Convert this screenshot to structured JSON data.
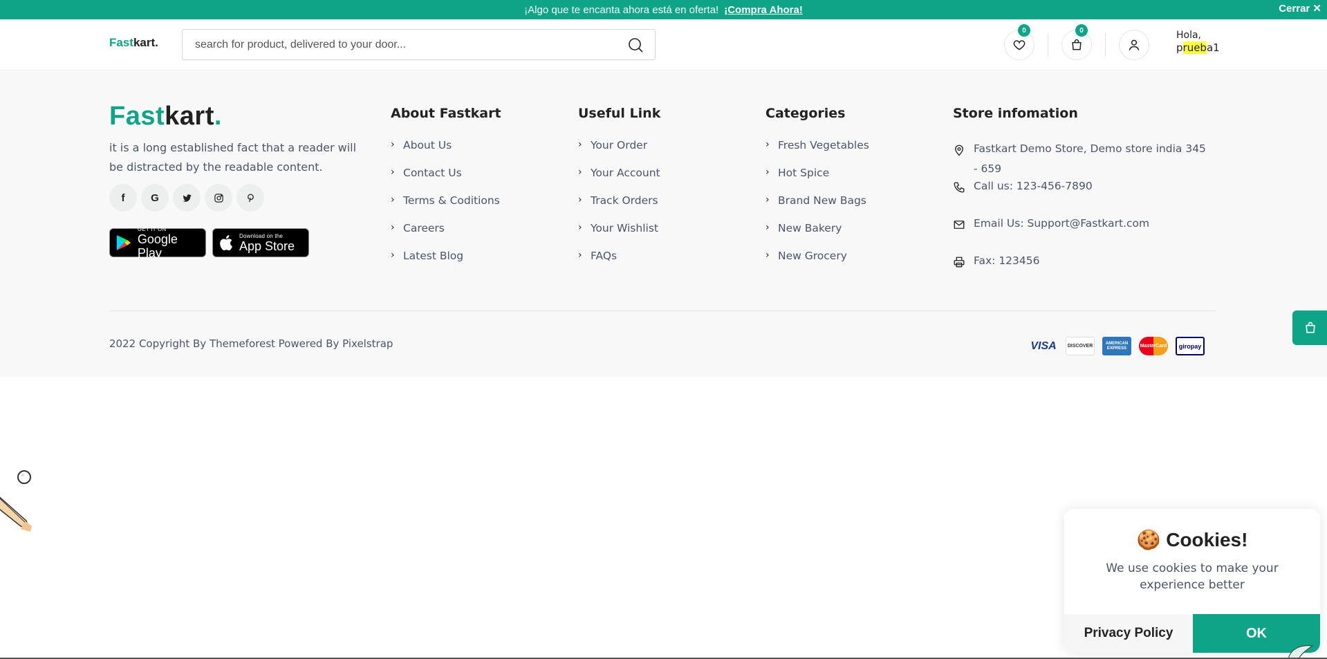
{
  "topbar": {
    "message": "¡Algo que te encanta ahora está en oferta!",
    "link": "¡Compra Ahora!",
    "close": "Cerrar"
  },
  "header": {
    "logo_main": "Fast",
    "logo_rest": "kart.",
    "search_placeholder": "search for product, delivered to your door...",
    "wishlist_count": "0",
    "cart_count": "0",
    "greeting": "Hola,",
    "user_name_prefix": "p",
    "user_name_highlight": "rueb",
    "user_name_suffix": "a1"
  },
  "footer": {
    "logo_main": "Fast",
    "logo_rest": "kart",
    "logo_dot": ".",
    "description": "it is a long established fact that a reader will be distracted by the readable content.",
    "socials": [
      "facebook-icon",
      "google-icon",
      "twitter-icon",
      "instagram-icon",
      "pinterest-icon"
    ],
    "app_stores": {
      "google_small": "GET IT ON",
      "google_big": "Google Play",
      "apple_small": "Download on the",
      "apple_big": "App Store"
    },
    "columns": {
      "about": {
        "title": "About Fastkart",
        "items": [
          "About Us",
          "Contact Us",
          "Terms & Coditions",
          "Careers",
          "Latest Blog"
        ]
      },
      "useful": {
        "title": "Useful Link",
        "items": [
          "Your Order",
          "Your Account",
          "Track Orders",
          "Your Wishlist",
          "FAQs"
        ]
      },
      "categories": {
        "title": "Categories",
        "items": [
          "Fresh Vegetables",
          "Hot Spice",
          "Brand New Bags",
          "New Bakery",
          "New Grocery"
        ]
      },
      "store": {
        "title": "Store infomation",
        "address": "Fastkart Demo Store, Demo store india 345 - 659",
        "phone": "Call us: 123-456-7890",
        "email": "Email Us: Support@Fastkart.com",
        "fax": "Fax: 123456"
      }
    },
    "copyright": "2022 Copyright By Themeforest Powered By Pixelstrap",
    "payments": [
      "VISA",
      "DISCOVER",
      "AMERICAN EXPRESS",
      "MasterCard",
      "giropay"
    ]
  },
  "cookie": {
    "title": "Cookies!",
    "text": "We use cookies to make your experience better",
    "privacy": "Privacy Policy",
    "ok": "OK"
  },
  "colors": {
    "brand": "#0da487",
    "footer_bg": "#f8f8f8",
    "highlight": "#ffff3b"
  }
}
